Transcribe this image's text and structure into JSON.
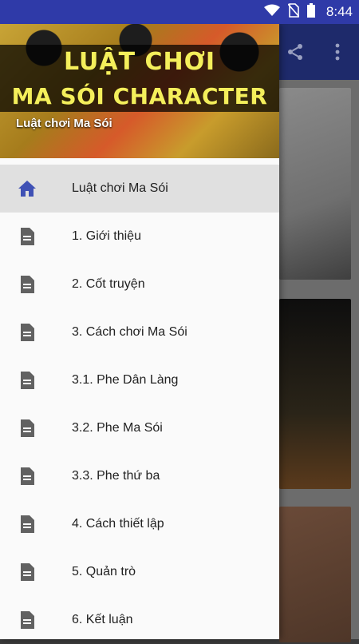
{
  "status_bar": {
    "time": "8:44"
  },
  "drawer": {
    "header": {
      "banner_line1": "LUẬT CHƠI",
      "banner_line2": "MA SÓI CHARACTER",
      "title": "Luật chơi Ma Sói"
    },
    "items": [
      {
        "label": "Luật chơi Ma Sói",
        "icon": "home-icon",
        "active": true
      },
      {
        "label": "1. Giới thiệu",
        "icon": "document-icon"
      },
      {
        "label": "2. Cốt truyện",
        "icon": "document-icon"
      },
      {
        "label": "3. Cách chơi Ma Sói",
        "icon": "document-icon"
      },
      {
        "label": "3.1. Phe Dân Làng",
        "icon": "document-icon"
      },
      {
        "label": "3.2. Phe Ma Sói",
        "icon": "document-icon"
      },
      {
        "label": "3.3. Phe thứ ba",
        "icon": "document-icon"
      },
      {
        "label": "4. Cách thiết lập",
        "icon": "document-icon"
      },
      {
        "label": "5. Quản trò",
        "icon": "document-icon"
      },
      {
        "label": "6. Kết luận",
        "icon": "document-icon"
      }
    ]
  },
  "toolbar": {
    "actions": [
      "share-icon",
      "overflow-menu-icon"
    ]
  },
  "colors": {
    "status_bar": "#2f3aa8",
    "active_icon": "#3f51b5",
    "doc_icon": "#616161"
  }
}
